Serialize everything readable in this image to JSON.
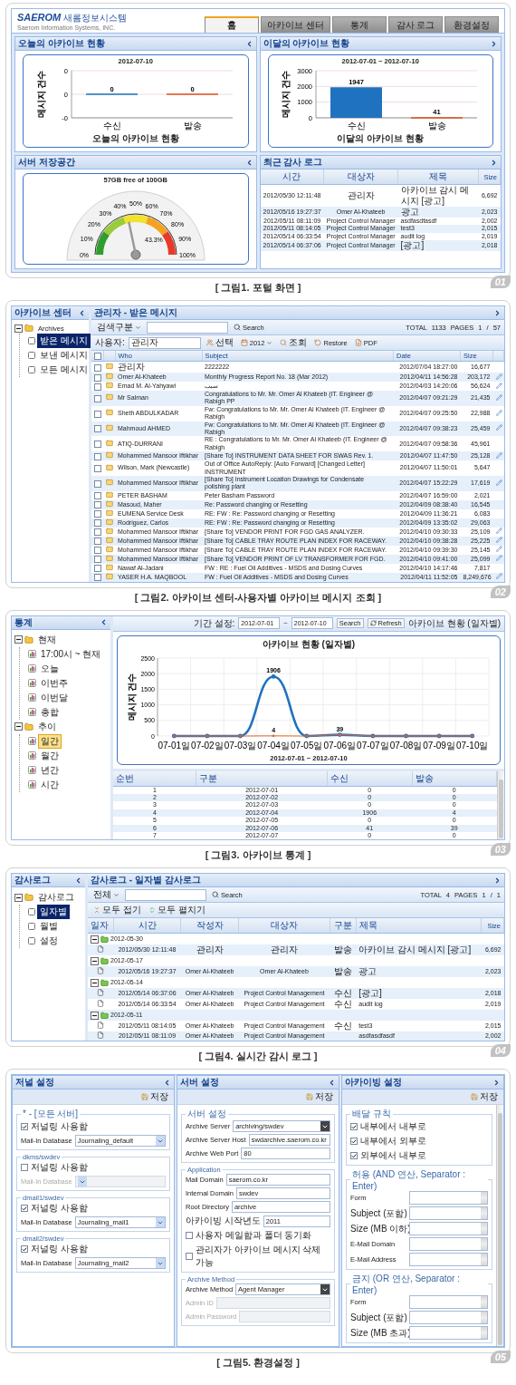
{
  "portal": {
    "logo": {
      "brand": "SAEROM",
      "name": "새롬정보시스템",
      "tagline": "Saerom Information Systems, INC."
    },
    "tabs": [
      {
        "label": "홈",
        "selected": true
      },
      {
        "label": "아카이브 센터",
        "selected": false
      },
      {
        "label": "통계",
        "selected": false
      },
      {
        "label": "감사 로그",
        "selected": false
      },
      {
        "label": "환경설정",
        "selected": false
      }
    ],
    "today_panel": {
      "title": "오늘의 아카이브 현황",
      "chart_data": {
        "type": "bar",
        "title": "2012-07-10",
        "xlabel": "오늘의 아카이브 현황",
        "ylabel": "메시지 건수",
        "categories": [
          "수신",
          "발송"
        ],
        "series": [
          {
            "color": "#1f72c0",
            "values": [
              0,
              null
            ]
          },
          {
            "color": "#d9531e",
            "values": [
              null,
              0
            ]
          }
        ],
        "ylim": [
          -0.4,
          0.4
        ],
        "yticks": [
          {
            "value": -0.4,
            "label": "-0"
          },
          {
            "value": 0,
            "label": "0"
          },
          {
            "value": 0.4,
            "label": "0"
          }
        ],
        "data_labels": true
      }
    },
    "month_panel": {
      "title": "이달의 아카이브 현황",
      "chart_data": {
        "type": "bar",
        "title": "2012-07-01 ~ 2012-07-10",
        "xlabel": "이달의 아카이브 현황",
        "ylabel": "메시지 건수",
        "categories": [
          "수신",
          "발송"
        ],
        "series": [
          {
            "color": "#1f72c0",
            "values": [
              1947,
              null
            ]
          },
          {
            "color": "#d9531e",
            "values": [
              null,
              41
            ]
          }
        ],
        "ylim": [
          0,
          3000
        ],
        "yticks": [
          0,
          1000,
          2000,
          3000
        ],
        "data_labels": true
      }
    },
    "storage_panel": {
      "title": "서버 저장공간",
      "gauge": {
        "title": "57GB free of 100GB",
        "level": 0.433,
        "reading": "43.3%",
        "ticks": [
          "0%",
          "10%",
          "20%",
          "30%",
          "40%",
          "50%",
          "60%",
          "70%",
          "80%",
          "90%",
          "100%"
        ]
      }
    },
    "audit_panel": {
      "title": "최근 감사 로그",
      "columns": [
        "시간",
        "대상자",
        "제목",
        "Size"
      ],
      "rows": [
        [
          "2012/05/30 12:11:48",
          "관리자",
          "아카이브 감시 메시지 [광고]",
          "6,692"
        ],
        [
          "2012/05/16 19:27:37",
          "Omer Al-Khateeb",
          "광고",
          "2,023"
        ],
        [
          "2012/05/11 08:11:09",
          "Project Control Manager",
          "asdfasdfasdf",
          "2,002"
        ],
        [
          "2012/05/11 08:14:05",
          "Project Control Manager",
          "test3",
          "2,015"
        ],
        [
          "2012/05/14 06:33:54",
          "Project Control Manager",
          "audit log",
          "2,019"
        ],
        [
          "2012/05/14 06:37:06",
          "Project Control Manager",
          "[광고]",
          "2,018"
        ]
      ]
    },
    "badge": "01",
    "caption": "[ 그림1. 포털 화면 ]"
  },
  "archive_center": {
    "sidebar": {
      "title": "아카이브 센터",
      "tree": [
        {
          "label": "Archives",
          "selected": false,
          "expanded": true,
          "children": [
            {
              "label": "받은 메시지",
              "selected": true
            },
            {
              "label": "보낸 메시지",
              "selected": false
            },
            {
              "label": "모든 메시지",
              "selected": false
            }
          ]
        }
      ]
    },
    "title": "관리자 - 받은 메시지",
    "search": {
      "scope": "검색구분",
      "button": "Search",
      "paging": "TOTAL 1133 PAGES 1 / 57"
    },
    "user_bar": {
      "label": "사용자:",
      "value": "관리자",
      "actions": [
        {
          "label": "선택",
          "kind": "button"
        },
        {
          "label": "2012",
          "kind": "dropdown"
        },
        {
          "label": "조회",
          "kind": "button"
        },
        {
          "label": "Restore",
          "kind": "button"
        },
        {
          "label": "PDF",
          "kind": "button"
        }
      ]
    },
    "select_all": {
      "checked": false
    },
    "columns": [
      "Who",
      "Subject",
      "Date",
      "Size"
    ],
    "rows": [
      {
        "checked": false,
        "who": "관리자",
        "subject": "2222222",
        "date": "2012/07/04 18:27:00",
        "size": "16,677",
        "marked": false
      },
      {
        "checked": false,
        "who": "Omer Al-Khateeb",
        "subject": "Monthly Progress Report No. 18 (Mar 2012)",
        "date": "2012/04/11 14:56:28",
        "size": "203,172",
        "marked": true
      },
      {
        "checked": false,
        "who": "Emad M. Al-Yahyawi",
        "subject": "سبب",
        "date": "2012/04/03 14:20:06",
        "size": "56,624",
        "marked": true
      },
      {
        "checked": false,
        "who": "Mr Salman",
        "subject": "Congratulations to Mr. Mr. Omer Al Khateeb (IT. Engineer @ Rabigh PP",
        "date": "2012/04/07 09:21:29",
        "size": "21,435",
        "marked": true
      },
      {
        "checked": false,
        "who": "Sheth ABDULKADAR",
        "subject": "Fw: Congratulations to Mr. Mr. Omer Al Khateeb (IT. Engineer @ Rabigh",
        "date": "2012/04/07 09:25:50",
        "size": "22,988",
        "marked": true
      },
      {
        "checked": false,
        "who": "Mahmoud AHMED",
        "subject": "Fw: Congratulations to Mr. Mr. Omer Al Khateeb (IT. Engineer @ Rabigh",
        "date": "2012/04/07 09:38:23",
        "size": "25,459",
        "marked": true
      },
      {
        "checked": false,
        "who": "ATIQ-DURRANI",
        "subject": "RE : Congratulations to Mr. Mr. Omer Al Khateeb (IT. Engineer @ Rabigh",
        "date": "2012/04/07 09:58:36",
        "size": "45,961",
        "marked": false
      },
      {
        "checked": false,
        "who": "Mohammed Mansoor Iftikhar",
        "subject": "[Share To] INSTRUMENT DATA SHEET FOR SWAS Rev. 1.",
        "date": "2012/04/07 11:47:50",
        "size": "25,128",
        "marked": true
      },
      {
        "checked": false,
        "who": "Wilson, Mark (Newcastle)",
        "subject": "Out of Office AutoReply: [Auto Forward] [Changed Letter] INSTRUMENT",
        "date": "2012/04/07 11:50:01",
        "size": "5,647",
        "marked": false
      },
      {
        "checked": false,
        "who": "Mohammed Mansoor Iftikhar",
        "subject": "[Share To] Instrument Location Drawings for Condensate polishing plant",
        "date": "2012/04/07 15:22:29",
        "size": "17,619",
        "marked": true
      },
      {
        "checked": false,
        "who": "PETER BASHAM",
        "subject": "Peter Basham Password",
        "date": "2012/04/07 16:59:00",
        "size": "2,021",
        "marked": false
      },
      {
        "checked": false,
        "who": "Masoud, Maher",
        "subject": "Re: Password changing or Resetting",
        "date": "2012/04/09 08:38:40",
        "size": "16,545",
        "marked": false
      },
      {
        "checked": false,
        "who": "EUMENA Service Desk",
        "subject": "RE: FW : Re: Password changing or Resetting",
        "date": "2012/04/09 11:36:21",
        "size": "6,083",
        "marked": false
      },
      {
        "checked": false,
        "who": "Rodriguez, Carlos",
        "subject": "RE: FW : Re: Password changing or Resetting",
        "date": "2012/04/09 13:35:02",
        "size": "29,063",
        "marked": false
      },
      {
        "checked": false,
        "who": "Mohammed Mansoor Iftikhar",
        "subject": "[Share To] VENDOR PRINT FOR FGD GAS ANALYZER.",
        "date": "2012/04/10 09:30:33",
        "size": "25,109",
        "marked": true
      },
      {
        "checked": false,
        "who": "Mohammed Mansoor Iftikhar",
        "subject": "[Share To] CABLE TRAY ROUTE PLAN INDEX FOR RACEWAY.",
        "date": "2012/04/10 09:38:28",
        "size": "25,225",
        "marked": true
      },
      {
        "checked": false,
        "who": "Mohammed Mansoor Iftikhar",
        "subject": "[Share To] CABLE TRAY ROUTE PLAN INDEX FOR RACEWAY.",
        "date": "2012/04/10 09:39:30",
        "size": "25,145",
        "marked": true
      },
      {
        "checked": false,
        "who": "Mohammed Mansoor Iftikhar",
        "subject": "[Share To] VENDOR PRINT OF LV TRANSFORMER FOR FGD.",
        "date": "2012/04/10 09:41:00",
        "size": "25,099",
        "marked": true
      },
      {
        "checked": false,
        "who": "Nawaf Al-Jadani",
        "subject": "FW : RE : Fuel Oil Additives - MSDS and Dosing Curves",
        "date": "2012/04/10 14:17:46",
        "size": "7,817",
        "marked": false
      },
      {
        "checked": false,
        "who": "YASER H.A. MAQBOOL",
        "subject": "FW : Fuel Oil Additives - MSDS and Dosing Curves",
        "date": "2012/04/11 11:52:05",
        "size": "8,249,676",
        "marked": true
      }
    ],
    "badge": "02",
    "caption": "[ 그림2. 아카이브 센터-사용자별 아카이브 메시지 조회 ]"
  },
  "statistics": {
    "sidebar": {
      "title": "통계",
      "tree": [
        {
          "label": "현재",
          "selected": false,
          "expanded": true,
          "children": [
            {
              "label": "17:00시 ~ 현재",
              "selected": false
            },
            {
              "label": "오늘",
              "selected": false
            },
            {
              "label": "이번주",
              "selected": false
            },
            {
              "label": "이번달",
              "selected": false
            },
            {
              "label": "총합",
              "selected": false
            }
          ]
        },
        {
          "label": "추이",
          "selected": false,
          "expanded": true,
          "children": [
            {
              "label": "일간",
              "selected": true
            },
            {
              "label": "월간",
              "selected": false
            },
            {
              "label": "년간",
              "selected": false
            },
            {
              "label": "시간",
              "selected": false
            }
          ]
        }
      ]
    },
    "period": {
      "label": "기간 설정:",
      "from": "2012-07-01",
      "separator": "~",
      "to": "2012-07-10",
      "search": "Search",
      "refresh": "Refresh",
      "view": "아카이브 현황 (일자별)"
    },
    "chart_data": {
      "type": "line",
      "title": "아카이브 현황 (일자별)",
      "xlabel": "2012-07-01 ~ 2012-07-10",
      "ylabel": "메시지 건수",
      "categories": [
        "07-01일",
        "07-02일",
        "07-03일",
        "07-04일",
        "07-05일",
        "07-06일",
        "07-07일",
        "07-08일",
        "07-09일",
        "07-10일"
      ],
      "series": [
        {
          "color": "#1f72c0",
          "values": [
            0,
            0,
            0,
            1906,
            0,
            41,
            0,
            0,
            0,
            0
          ]
        },
        {
          "color": "#e0642c",
          "values": [
            0,
            0,
            0,
            4,
            0,
            39,
            0,
            0,
            0,
            0
          ]
        }
      ],
      "ylim": [
        0,
        2500
      ],
      "yticks": [
        0,
        500,
        1000,
        1500,
        2000,
        2500
      ],
      "grid": true,
      "annotations": [
        {
          "x": "07-04일",
          "y": 1906,
          "text": "1906"
        },
        {
          "x": "07-04일",
          "y": 4,
          "text": "4"
        },
        {
          "x": "07-06일",
          "y": 39,
          "text": "39"
        }
      ]
    },
    "table": {
      "columns": [
        "순번",
        "구분",
        "수신",
        "발송"
      ],
      "rows": [
        [
          "1",
          "2012-07-01",
          "0",
          "0"
        ],
        [
          "2",
          "2012-07-02",
          "0",
          "0"
        ],
        [
          "3",
          "2012-07-03",
          "0",
          "0"
        ],
        [
          "4",
          "2012-07-04",
          "1906",
          "4"
        ],
        [
          "5",
          "2012-07-05",
          "0",
          "0"
        ],
        [
          "6",
          "2012-07-06",
          "41",
          "39"
        ],
        [
          "7",
          "2012-07-07",
          "0",
          "0"
        ]
      ]
    },
    "badge": "03",
    "caption": "[ 그림3. 아카이브 통계 ]"
  },
  "audit_log": {
    "sidebar": {
      "title": "감사로그",
      "tree": [
        {
          "label": "감사로그",
          "selected": false,
          "expanded": true,
          "children": [
            {
              "label": "일자별",
              "selected": true
            },
            {
              "label": "월별",
              "selected": false
            },
            {
              "label": "설정",
              "selected": false
            }
          ]
        }
      ]
    },
    "title": "감사로그 - 일자별 감사로그",
    "search": {
      "scope": "전체",
      "button": "Search",
      "paging": "TOTAL 4 PAGES 1 / 1"
    },
    "actions": [
      "모두 접기",
      "모두 펼치기"
    ],
    "columns": [
      "일자",
      "시간",
      "작성자",
      "대상자",
      "구분",
      "제목",
      "Size"
    ],
    "groups": [
      {
        "date": "2012-05-30",
        "expanded": true,
        "rows": [
          {
            "time": "2012/05/30 12:11:48",
            "author": "관리자",
            "target": "관리자",
            "type": "발송",
            "subject": "아카이브 감시 메시지 [광고]",
            "size": "6,692"
          }
        ]
      },
      {
        "date": "2012-05-17",
        "expanded": true,
        "rows": [
          {
            "time": "2012/05/16 19:27:37",
            "author": "Omer Al-Khateeb",
            "target": "Omer Al-Khateeb",
            "type": "발송",
            "subject": "광고",
            "size": "2,023"
          }
        ]
      },
      {
        "date": "2012-05-14",
        "expanded": true,
        "rows": [
          {
            "time": "2012/05/14 06:37:06",
            "author": "Omer Al-Khateeb",
            "target": "Project Control Management",
            "type": "수신",
            "subject": "[광고]",
            "size": "2,018"
          },
          {
            "time": "2012/05/14 06:33:54",
            "author": "Omer Al-Khateeb",
            "target": "Project Control Management",
            "type": "수신",
            "subject": "audit log",
            "size": "2,019"
          }
        ]
      },
      {
        "date": "2012-05-11",
        "expanded": true,
        "rows": [
          {
            "time": "2012/05/11 08:14:05",
            "author": "Omer Al-Khateeb",
            "target": "Project Control Management",
            "type": "수신",
            "subject": "test3",
            "size": "2,015"
          },
          {
            "time": "2012/05/11 08:11:09",
            "author": "Omer Al-Khateeb",
            "target": "Project Control Management",
            "subject": "asdfasdfasdf",
            "size": "2,002"
          }
        ]
      }
    ],
    "badge": "04",
    "caption": "[ 그림4. 실시간 감시 로그 ]"
  },
  "settings": {
    "journal": {
      "title": "저널 설정",
      "save": "저장",
      "groups": [
        {
          "legend": "* - [모든 서버]",
          "checkbox": {
            "label": "저널링 사용함",
            "checked": true
          },
          "field": {
            "label": "Mail-In Database",
            "value": "Journaling_default",
            "disabled": false
          }
        },
        {
          "legend": "dkms/swdev",
          "checkbox": {
            "label": "저널링 사용함",
            "checked": false
          },
          "field": {
            "label": "Mail-In Database",
            "disabled": true
          }
        },
        {
          "legend": "dmail1/swdev",
          "checkbox": {
            "label": "저널링 사용함",
            "checked": true
          },
          "field": {
            "label": "Mail-In Database",
            "value": "Journaling_mail1",
            "disabled": false
          }
        },
        {
          "legend": "dmail2/swdev",
          "checkbox": {
            "label": "저널링 사용함",
            "checked": true
          },
          "field": {
            "label": "Mail-In Database",
            "value": "Journaling_mail2",
            "disabled": false
          }
        }
      ]
    },
    "server": {
      "title": "서버 설정",
      "save": "저장",
      "groups": [
        {
          "legend": "서버 설정",
          "fields": [
            {
              "label": "Archive Server",
              "kind": "select",
              "value": "archiving/swdev",
              "disabled": false
            },
            {
              "label": "Archive Server Host",
              "kind": "input",
              "value": "swdarchive.saerom.co.kr",
              "disabled": false
            },
            {
              "label": "Archive Web Port",
              "kind": "input",
              "value": "80",
              "disabled": false
            }
          ]
        },
        {
          "legend": "Application",
          "fields": [
            {
              "label": "Mail Domain",
              "kind": "input",
              "value": "saerom.co.kr",
              "disabled": false
            },
            {
              "label": "Internal Domain",
              "kind": "input",
              "value": "swdev",
              "disabled": false
            },
            {
              "label": "Root Directory",
              "kind": "input",
              "value": "archive",
              "disabled": false
            },
            {
              "label": "아카이빙 시작년도",
              "kind": "input",
              "value": "2011",
              "disabled": false
            }
          ],
          "checkboxes": [
            {
              "label": "사용자 메일함과 폴더 동기화",
              "checked": false
            },
            {
              "label": "관리자가 아카이브 메시지 삭제 가능",
              "checked": false
            }
          ]
        },
        {
          "legend": "Archive Method",
          "fields": [
            {
              "label": "Archive Method",
              "kind": "select",
              "value": "Agent Manager",
              "disabled": false
            },
            {
              "label": "Admin ID",
              "kind": "input",
              "disabled": true
            },
            {
              "label": "Admin Password",
              "kind": "input",
              "disabled": true
            }
          ]
        }
      ]
    },
    "archiving": {
      "title": "아카이빙 설정",
      "save": "저장",
      "delivery": {
        "legend": "배달 규칙",
        "options": [
          {
            "label": "내부에서 내부로",
            "checked": true
          },
          {
            "label": "내부에서 외부로",
            "checked": true
          },
          {
            "label": "외부에서 내부로",
            "checked": true
          }
        ]
      },
      "allow": {
        "legend": "허용 (AND 연산, Separator : Enter)",
        "fields": [
          "Form",
          "Subject (포함)",
          "Size (MB 이하)",
          "E-Mail Domain",
          "E-Mail Address"
        ]
      },
      "deny": {
        "legend": "금지 (OR 연산, Separator : Enter)",
        "fields": [
          "Form",
          "Subject (포함)",
          "Size (MB 초과)"
        ]
      }
    },
    "badge": "05",
    "caption": "[ 그림5. 환경설정 ]"
  }
}
